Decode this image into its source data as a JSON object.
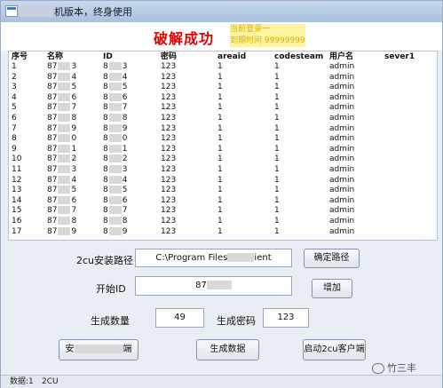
{
  "window": {
    "title": "机版本，终身使用"
  },
  "banner": {
    "crack_text": "破解成功",
    "login_line1": "当前登录一",
    "login_line2": "到期时间 99999999"
  },
  "table": {
    "headers": [
      "序号",
      "名称",
      "ID",
      "密码",
      "areaid",
      "codesteam",
      "用户名",
      "sever1"
    ],
    "rows": [
      {
        "no": "1",
        "name_a": "87",
        "name_b": "3",
        "id_a": "8",
        "id_b": "3",
        "pwd": "123",
        "areaid": "1",
        "codesteam": "1",
        "user": "admin"
      },
      {
        "no": "2",
        "name_a": "87",
        "name_b": "4",
        "id_a": "8",
        "id_b": "4",
        "pwd": "123",
        "areaid": "1",
        "codesteam": "1",
        "user": "admin"
      },
      {
        "no": "3",
        "name_a": "87",
        "name_b": "5",
        "id_a": "8",
        "id_b": "5",
        "pwd": "123",
        "areaid": "1",
        "codesteam": "1",
        "user": "admin"
      },
      {
        "no": "4",
        "name_a": "87",
        "name_b": "6",
        "id_a": "8",
        "id_b": "6",
        "pwd": "123",
        "areaid": "1",
        "codesteam": "1",
        "user": "admin"
      },
      {
        "no": "5",
        "name_a": "87",
        "name_b": "7",
        "id_a": "8",
        "id_b": "7",
        "pwd": "123",
        "areaid": "1",
        "codesteam": "1",
        "user": "admin"
      },
      {
        "no": "6",
        "name_a": "87",
        "name_b": "8",
        "id_a": "8",
        "id_b": "8",
        "pwd": "123",
        "areaid": "1",
        "codesteam": "1",
        "user": "admin"
      },
      {
        "no": "7",
        "name_a": "87",
        "name_b": "9",
        "id_a": "8",
        "id_b": "9",
        "pwd": "123",
        "areaid": "1",
        "codesteam": "1",
        "user": "admin"
      },
      {
        "no": "8",
        "name_a": "87",
        "name_b": "0",
        "id_a": "8",
        "id_b": "0",
        "pwd": "123",
        "areaid": "1",
        "codesteam": "1",
        "user": "admin"
      },
      {
        "no": "9",
        "name_a": "87",
        "name_b": "1",
        "id_a": "8",
        "id_b": "1",
        "pwd": "123",
        "areaid": "1",
        "codesteam": "1",
        "user": "admin"
      },
      {
        "no": "10",
        "name_a": "87",
        "name_b": "2",
        "id_a": "8",
        "id_b": "2",
        "pwd": "123",
        "areaid": "1",
        "codesteam": "1",
        "user": "admin"
      },
      {
        "no": "11",
        "name_a": "87",
        "name_b": "3",
        "id_a": "8",
        "id_b": "3",
        "pwd": "123",
        "areaid": "1",
        "codesteam": "1",
        "user": "admin"
      },
      {
        "no": "12",
        "name_a": "87",
        "name_b": "4",
        "id_a": "8",
        "id_b": "4",
        "pwd": "123",
        "areaid": "1",
        "codesteam": "1",
        "user": "admin"
      },
      {
        "no": "13",
        "name_a": "87",
        "name_b": "5",
        "id_a": "8",
        "id_b": "5",
        "pwd": "123",
        "areaid": "1",
        "codesteam": "1",
        "user": "admin"
      },
      {
        "no": "14",
        "name_a": "87",
        "name_b": "6",
        "id_a": "8",
        "id_b": "6",
        "pwd": "123",
        "areaid": "1",
        "codesteam": "1",
        "user": "admin"
      },
      {
        "no": "15",
        "name_a": "87",
        "name_b": "7",
        "id_a": "8",
        "id_b": "7",
        "pwd": "123",
        "areaid": "1",
        "codesteam": "1",
        "user": "admin"
      },
      {
        "no": "16",
        "name_a": "87",
        "name_b": "8",
        "id_a": "8",
        "id_b": "8",
        "pwd": "123",
        "areaid": "1",
        "codesteam": "1",
        "user": "admin"
      },
      {
        "no": "17",
        "name_a": "87",
        "name_b": "9",
        "id_a": "8",
        "id_b": "9",
        "pwd": "123",
        "areaid": "1",
        "codesteam": "1",
        "user": "admin"
      }
    ]
  },
  "form": {
    "install_path_label": "2cu安装路径",
    "install_path_prefix": "C:\\Program Files",
    "install_path_suffix": "ient",
    "confirm_path_button": "确定路径",
    "start_id_label": "开始ID",
    "start_id_prefix": "87",
    "add_button": "增加",
    "count_label": "生成数量",
    "count_value": "49",
    "pwd_label": "生成密码",
    "pwd_value": "123",
    "install_button_prefix": "安",
    "install_button_suffix": "端",
    "generate_button": "生成数据",
    "launch_button": "启动2cu客户端"
  },
  "status": {
    "left": "数据:1",
    "right": "2CU"
  },
  "watermark": {
    "text": "竹三丰"
  }
}
